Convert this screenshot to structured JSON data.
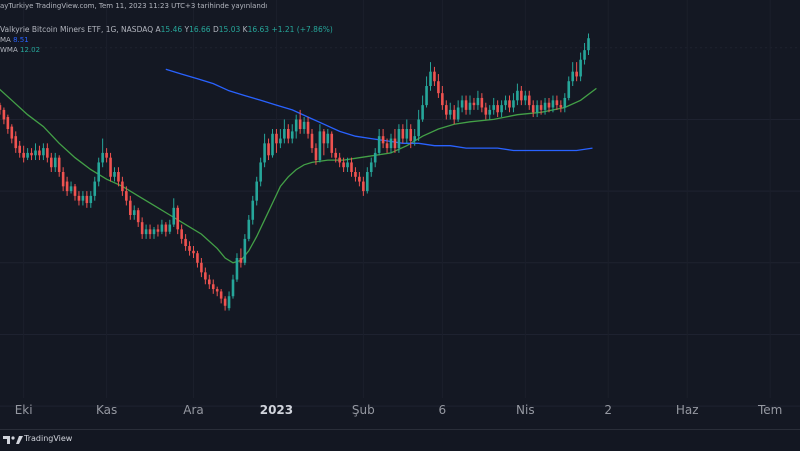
{
  "header": {
    "published_line": "ayTurkiye TradingView.com, Tem 11, 2023 11:23 UTC+3 tarihinde yayınlandı",
    "symbol_line": {
      "name": "Valkyrie Bitcoin Miners ETF, 1G, NASDAQ",
      "open_label": "A",
      "open_value": "15.46",
      "high_label": "Y",
      "high_value": "16.66",
      "low_label": "D",
      "low_value": "15.03",
      "close_label": "K",
      "close_value": "16.63",
      "change": "+1.21 (+7.86%)"
    },
    "ma_label": "MA",
    "ma_value": "8.51",
    "wma_label": "WMA",
    "wma_value": "12.02"
  },
  "footer": {
    "brand": "TradingView"
  },
  "colors": {
    "background": "#141823",
    "up": "#26a69a",
    "down": "#ef5350",
    "ma_line": "#2962ff",
    "wma_line": "#43a047"
  },
  "chart_data": {
    "type": "line",
    "chart_style": "candlestick",
    "ylim": [
      2,
      20
    ],
    "x_ticks": [
      {
        "label": "Eki",
        "x": 7,
        "bold": false
      },
      {
        "label": "Kas",
        "x": 28,
        "bold": false
      },
      {
        "label": "Ara",
        "x": 50,
        "bold": false
      },
      {
        "label": "2023",
        "x": 71,
        "bold": true
      },
      {
        "label": "Şub",
        "x": 93,
        "bold": false
      },
      {
        "label": "6",
        "x": 113,
        "bold": false
      },
      {
        "label": "Nis",
        "x": 134,
        "bold": false
      },
      {
        "label": "2",
        "x": 155,
        "bold": false
      },
      {
        "label": "Haz",
        "x": 175,
        "bold": false
      },
      {
        "label": "Tem",
        "x": 196,
        "bold": false
      }
    ],
    "candles": [
      [
        1,
        15.6,
        15.4,
        15.7,
        15.2
      ],
      [
        2,
        15.4,
        15.0,
        15.5,
        14.8
      ],
      [
        3,
        15.1,
        14.6,
        15.2,
        14.4
      ],
      [
        4,
        14.7,
        14.2,
        14.8,
        14.0
      ],
      [
        5,
        14.3,
        13.8,
        14.5,
        13.6
      ],
      [
        6,
        13.9,
        13.6,
        14.1,
        13.4
      ],
      [
        7,
        13.6,
        13.4,
        13.9,
        13.2
      ],
      [
        8,
        13.4,
        13.6,
        13.8,
        13.3
      ],
      [
        9,
        13.6,
        13.5,
        13.8,
        13.3
      ],
      [
        10,
        13.5,
        13.7,
        14.0,
        13.3
      ],
      [
        11,
        13.7,
        13.5,
        13.9,
        13.3
      ],
      [
        12,
        13.5,
        13.8,
        14.0,
        13.3
      ],
      [
        13,
        13.8,
        13.4,
        14.0,
        13.2
      ],
      [
        14,
        13.4,
        13.0,
        13.6,
        12.8
      ],
      [
        15,
        13.0,
        13.4,
        13.6,
        12.8
      ],
      [
        16,
        13.4,
        12.8,
        13.5,
        12.6
      ],
      [
        17,
        12.8,
        12.2,
        13.0,
        12.0
      ],
      [
        18,
        12.4,
        12.0,
        12.6,
        11.8
      ],
      [
        19,
        12.0,
        12.2,
        12.4,
        11.9
      ],
      [
        20,
        12.2,
        11.8,
        12.3,
        11.6
      ],
      [
        21,
        11.8,
        11.6,
        12.0,
        11.4
      ],
      [
        22,
        11.6,
        11.8,
        12.0,
        11.4
      ],
      [
        23,
        11.8,
        11.5,
        12.0,
        11.3
      ],
      [
        24,
        11.5,
        11.8,
        12.0,
        11.3
      ],
      [
        25,
        11.8,
        12.4,
        12.6,
        11.6
      ],
      [
        26,
        12.4,
        13.2,
        13.4,
        12.2
      ],
      [
        27,
        13.2,
        13.6,
        14.2,
        13.0
      ],
      [
        28,
        13.6,
        13.4,
        13.8,
        13.2
      ],
      [
        29,
        13.4,
        12.6,
        13.6,
        12.4
      ],
      [
        30,
        12.6,
        12.8,
        13.0,
        12.4
      ],
      [
        31,
        12.8,
        12.4,
        13.0,
        12.2
      ],
      [
        32,
        12.4,
        12.0,
        12.6,
        11.8
      ],
      [
        33,
        12.0,
        11.6,
        12.2,
        11.4
      ],
      [
        34,
        11.6,
        11.0,
        11.8,
        10.8
      ],
      [
        35,
        11.0,
        11.2,
        11.4,
        10.8
      ],
      [
        36,
        11.2,
        10.7,
        11.3,
        10.5
      ],
      [
        37,
        10.7,
        10.2,
        10.9,
        10.0
      ],
      [
        38,
        10.2,
        10.4,
        10.6,
        10.0
      ],
      [
        39,
        10.4,
        10.2,
        10.6,
        10.0
      ],
      [
        40,
        10.2,
        10.4,
        10.5,
        10.0
      ],
      [
        41,
        10.4,
        10.3,
        10.6,
        10.1
      ],
      [
        42,
        10.3,
        10.6,
        10.8,
        10.2
      ],
      [
        43,
        10.6,
        10.3,
        10.7,
        10.1
      ],
      [
        44,
        10.3,
        10.6,
        10.8,
        10.2
      ],
      [
        45,
        10.6,
        11.3,
        11.7,
        10.5
      ],
      [
        46,
        11.3,
        10.4,
        11.4,
        10.2
      ],
      [
        47,
        10.4,
        10.0,
        10.6,
        9.8
      ],
      [
        48,
        10.0,
        9.7,
        10.2,
        9.5
      ],
      [
        49,
        9.7,
        9.5,
        9.9,
        9.3
      ],
      [
        50,
        9.5,
        9.4,
        9.7,
        9.2
      ],
      [
        51,
        9.4,
        9.0,
        9.5,
        8.8
      ],
      [
        52,
        9.0,
        8.6,
        9.2,
        8.4
      ],
      [
        53,
        8.6,
        8.3,
        8.8,
        8.1
      ],
      [
        54,
        8.3,
        8.1,
        8.5,
        7.9
      ],
      [
        55,
        8.1,
        7.9,
        8.3,
        7.7
      ],
      [
        56,
        7.9,
        7.8,
        8.0,
        7.6
      ],
      [
        57,
        7.8,
        7.5,
        7.9,
        7.3
      ],
      [
        58,
        7.5,
        7.2,
        7.6,
        7.0
      ],
      [
        59,
        7.1,
        7.6,
        7.8,
        7.0
      ],
      [
        60,
        7.6,
        8.3,
        8.5,
        7.5
      ],
      [
        61,
        8.3,
        9.2,
        9.4,
        8.2
      ],
      [
        62,
        9.2,
        9.0,
        9.6,
        8.8
      ],
      [
        63,
        9.0,
        10.0,
        10.2,
        8.9
      ],
      [
        64,
        10.0,
        10.8,
        11.0,
        9.9
      ],
      [
        65,
        10.8,
        11.6,
        11.8,
        10.6
      ],
      [
        66,
        11.6,
        12.4,
        12.6,
        11.4
      ],
      [
        67,
        12.4,
        13.2,
        13.4,
        12.2
      ],
      [
        68,
        13.2,
        14.0,
        14.4,
        13.0
      ],
      [
        69,
        14.0,
        13.5,
        14.2,
        13.3
      ],
      [
        70,
        13.5,
        14.4,
        14.6,
        13.4
      ],
      [
        71,
        14.4,
        14.0,
        14.6,
        13.6
      ],
      [
        72,
        14.0,
        14.2,
        14.6,
        13.8
      ],
      [
        73,
        14.2,
        14.6,
        15.0,
        14.0
      ],
      [
        74,
        14.6,
        14.2,
        14.8,
        14.0
      ],
      [
        75,
        14.2,
        14.5,
        14.8,
        14.0
      ],
      [
        76,
        14.5,
        15.0,
        15.2,
        14.2
      ],
      [
        77,
        15.0,
        14.6,
        15.4,
        14.4
      ],
      [
        78,
        14.6,
        14.9,
        15.1,
        14.4
      ],
      [
        79,
        14.9,
        14.4,
        15.1,
        14.2
      ],
      [
        80,
        14.4,
        13.8,
        14.6,
        13.6
      ],
      [
        81,
        13.8,
        13.3,
        14.0,
        13.1
      ],
      [
        82,
        13.3,
        14.5,
        14.8,
        13.2
      ],
      [
        83,
        14.5,
        14.0,
        14.6,
        13.5
      ],
      [
        84,
        14.0,
        14.4,
        14.6,
        13.8
      ],
      [
        85,
        14.4,
        13.6,
        14.5,
        13.4
      ],
      [
        86,
        13.6,
        13.4,
        13.8,
        13.2
      ],
      [
        87,
        13.4,
        13.2,
        13.6,
        13.0
      ],
      [
        88,
        13.2,
        13.0,
        13.4,
        12.8
      ],
      [
        89,
        13.0,
        13.2,
        13.4,
        12.8
      ],
      [
        90,
        13.2,
        12.8,
        13.4,
        12.6
      ],
      [
        91,
        12.8,
        12.6,
        13.0,
        12.4
      ],
      [
        92,
        12.6,
        12.4,
        12.8,
        12.2
      ],
      [
        93,
        12.4,
        12.0,
        12.6,
        11.8
      ],
      [
        94,
        12.0,
        12.8,
        13.0,
        11.9
      ],
      [
        95,
        12.8,
        13.2,
        13.4,
        12.6
      ],
      [
        96,
        13.2,
        13.6,
        13.8,
        13.0
      ],
      [
        97,
        13.6,
        14.3,
        14.6,
        13.5
      ],
      [
        98,
        14.3,
        14.0,
        14.6,
        13.8
      ],
      [
        99,
        14.0,
        13.8,
        14.2,
        13.6
      ],
      [
        100,
        13.8,
        14.2,
        14.4,
        13.6
      ],
      [
        101,
        14.2,
        13.8,
        14.6,
        13.6
      ],
      [
        102,
        13.8,
        14.6,
        14.8,
        13.6
      ],
      [
        103,
        14.6,
        14.2,
        14.8,
        14.0
      ],
      [
        104,
        14.2,
        14.6,
        15.0,
        14.0
      ],
      [
        105,
        14.6,
        14.1,
        14.8,
        13.8
      ],
      [
        106,
        14.1,
        14.3,
        14.6,
        13.9
      ],
      [
        107,
        14.3,
        15.0,
        15.4,
        14.1
      ],
      [
        108,
        15.0,
        15.6,
        16.0,
        14.9
      ],
      [
        109,
        15.6,
        16.4,
        16.8,
        15.5
      ],
      [
        110,
        16.4,
        17.0,
        17.4,
        16.2
      ],
      [
        111,
        17.0,
        16.6,
        17.2,
        16.4
      ],
      [
        112,
        16.6,
        16.1,
        16.9,
        15.9
      ],
      [
        113,
        16.1,
        15.6,
        16.4,
        15.4
      ],
      [
        114,
        15.6,
        15.2,
        15.8,
        15.0
      ],
      [
        115,
        15.2,
        15.4,
        15.7,
        15.0
      ],
      [
        116,
        15.4,
        15.0,
        15.6,
        14.8
      ],
      [
        117,
        15.0,
        15.5,
        15.8,
        14.9
      ],
      [
        118,
        15.5,
        15.8,
        16.0,
        15.3
      ],
      [
        119,
        15.8,
        15.4,
        16.0,
        15.2
      ],
      [
        120,
        15.4,
        15.7,
        16.0,
        15.2
      ],
      [
        121,
        15.7,
        15.6,
        15.9,
        15.4
      ],
      [
        122,
        15.6,
        15.9,
        16.2,
        15.4
      ],
      [
        123,
        15.9,
        15.5,
        16.1,
        15.3
      ],
      [
        124,
        15.5,
        15.2,
        15.7,
        15.0
      ],
      [
        125,
        15.2,
        15.4,
        15.6,
        15.0
      ],
      [
        126,
        15.4,
        15.6,
        15.9,
        15.2
      ],
      [
        127,
        15.6,
        15.3,
        15.8,
        15.1
      ],
      [
        128,
        15.3,
        15.6,
        15.8,
        15.1
      ],
      [
        129,
        15.6,
        15.8,
        16.0,
        15.4
      ],
      [
        130,
        15.8,
        15.5,
        16.0,
        15.3
      ],
      [
        131,
        15.5,
        15.8,
        16.1,
        15.3
      ],
      [
        132,
        15.8,
        16.2,
        16.5,
        15.6
      ],
      [
        133,
        16.2,
        15.8,
        16.4,
        15.6
      ],
      [
        134,
        15.8,
        16.0,
        16.2,
        15.6
      ],
      [
        135,
        16.0,
        15.6,
        16.2,
        15.4
      ],
      [
        136,
        15.6,
        15.3,
        15.8,
        15.1
      ],
      [
        137,
        15.3,
        15.6,
        15.8,
        15.1
      ],
      [
        138,
        15.6,
        15.4,
        15.8,
        15.2
      ],
      [
        139,
        15.4,
        15.7,
        15.9,
        15.2
      ],
      [
        140,
        15.7,
        15.5,
        15.9,
        15.3
      ],
      [
        141,
        15.5,
        15.8,
        16.0,
        15.3
      ],
      [
        142,
        15.8,
        15.6,
        16.0,
        15.4
      ],
      [
        143,
        15.6,
        15.5,
        15.8,
        15.3
      ],
      [
        144,
        15.5,
        15.9,
        16.1,
        15.3
      ],
      [
        145,
        15.9,
        16.6,
        16.8,
        15.8
      ],
      [
        146,
        16.6,
        17.0,
        17.4,
        16.4
      ],
      [
        147,
        17.0,
        16.8,
        17.4,
        16.6
      ],
      [
        148,
        16.8,
        17.5,
        17.8,
        16.6
      ],
      [
        149,
        17.5,
        17.9,
        18.2,
        17.3
      ],
      [
        150,
        17.9,
        18.4,
        18.6,
        17.7
      ]
    ],
    "wma_series": [
      [
        0,
        16.4
      ],
      [
        4,
        15.8
      ],
      [
        8,
        15.2
      ],
      [
        12,
        14.7
      ],
      [
        16,
        14.0
      ],
      [
        20,
        13.4
      ],
      [
        24,
        12.9
      ],
      [
        28,
        12.5
      ],
      [
        32,
        12.2
      ],
      [
        36,
        11.8
      ],
      [
        40,
        11.4
      ],
      [
        44,
        11.0
      ],
      [
        48,
        10.6
      ],
      [
        52,
        10.2
      ],
      [
        56,
        9.6
      ],
      [
        58,
        9.2
      ],
      [
        60,
        9.0
      ],
      [
        62,
        9.1
      ],
      [
        64,
        9.5
      ],
      [
        66,
        10.1
      ],
      [
        68,
        10.8
      ],
      [
        70,
        11.5
      ],
      [
        72,
        12.2
      ],
      [
        74,
        12.6
      ],
      [
        76,
        12.9
      ],
      [
        78,
        13.1
      ],
      [
        80,
        13.2
      ],
      [
        84,
        13.3
      ],
      [
        88,
        13.3
      ],
      [
        92,
        13.4
      ],
      [
        96,
        13.5
      ],
      [
        100,
        13.6
      ],
      [
        104,
        13.9
      ],
      [
        108,
        14.3
      ],
      [
        112,
        14.6
      ],
      [
        116,
        14.8
      ],
      [
        120,
        14.9
      ],
      [
        126,
        15.0
      ],
      [
        132,
        15.2
      ],
      [
        138,
        15.3
      ],
      [
        144,
        15.5
      ],
      [
        148,
        15.8
      ],
      [
        152,
        16.3
      ]
    ],
    "ma_series": [
      [
        43,
        17.1
      ],
      [
        47,
        16.9
      ],
      [
        51,
        16.7
      ],
      [
        55,
        16.5
      ],
      [
        59,
        16.2
      ],
      [
        63,
        16.0
      ],
      [
        67,
        15.8
      ],
      [
        71,
        15.6
      ],
      [
        75,
        15.4
      ],
      [
        79,
        15.1
      ],
      [
        83,
        14.8
      ],
      [
        87,
        14.5
      ],
      [
        91,
        14.3
      ],
      [
        95,
        14.2
      ],
      [
        99,
        14.1
      ],
      [
        103,
        14.0
      ],
      [
        107,
        14.0
      ],
      [
        111,
        13.9
      ],
      [
        115,
        13.9
      ],
      [
        119,
        13.8
      ],
      [
        123,
        13.8
      ],
      [
        127,
        13.8
      ],
      [
        131,
        13.7
      ],
      [
        135,
        13.7
      ],
      [
        139,
        13.7
      ],
      [
        143,
        13.7
      ],
      [
        147,
        13.7
      ],
      [
        151,
        13.8
      ]
    ]
  }
}
